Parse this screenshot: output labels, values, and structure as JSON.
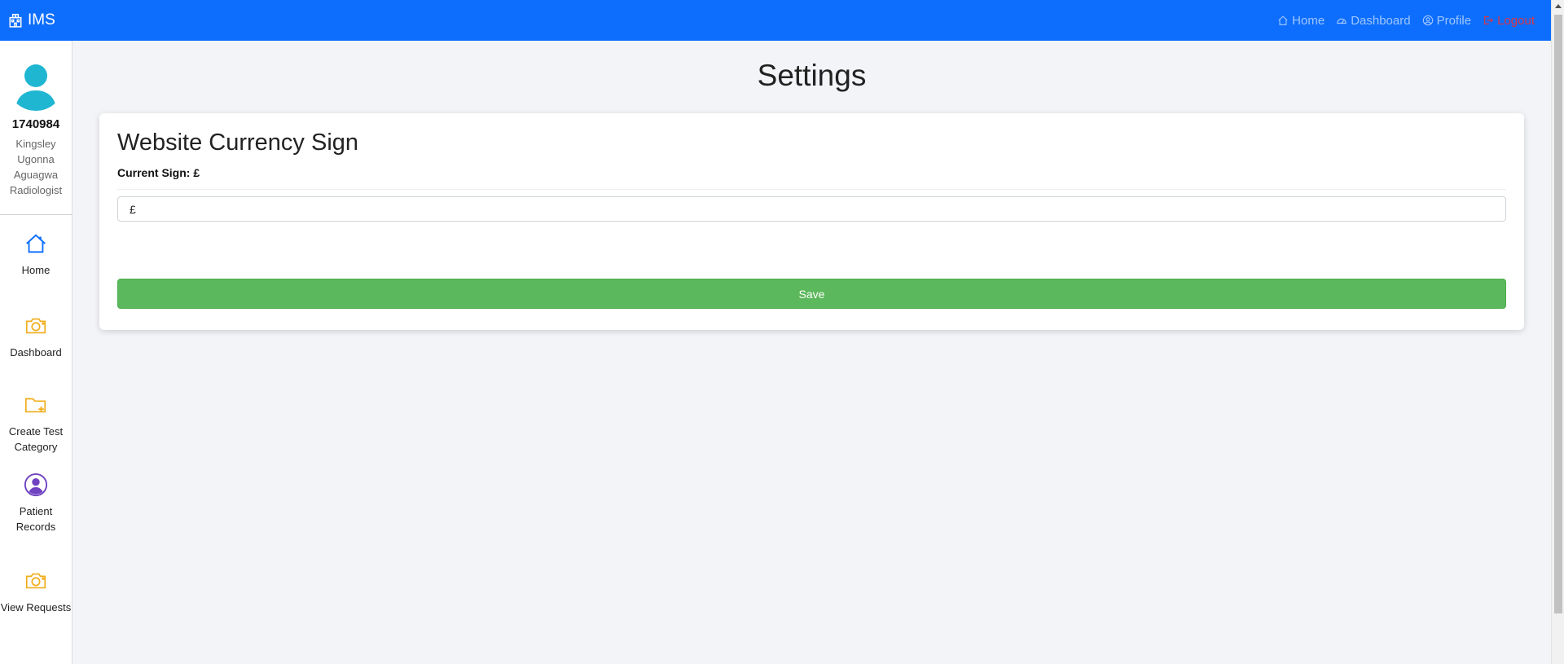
{
  "navbar": {
    "brand": "IMS",
    "links": {
      "home": "Home",
      "dashboard": "Dashboard",
      "profile": "Profile",
      "logout": "Logout"
    }
  },
  "sidebar": {
    "user_id": "1740984",
    "user_name": "Kingsley Ugonna Aguagwa",
    "user_role": "Radiologist",
    "items": [
      {
        "label": "Home",
        "icon": "home-icon",
        "color": "#0d6efd"
      },
      {
        "label": "Dashboard",
        "icon": "camera-icon",
        "color": "#f0ad1a"
      },
      {
        "label": "Create Test Category",
        "icon": "folder-plus-icon",
        "color": "#f0ad1a"
      },
      {
        "label": "Patient Records",
        "icon": "person-circle-icon",
        "color": "#6f42c1"
      },
      {
        "label": "View Requests",
        "icon": "camera-icon",
        "color": "#f0ad1a"
      }
    ]
  },
  "main": {
    "title": "Settings",
    "card": {
      "title": "Website Currency Sign",
      "current_sign": "Current Sign: £",
      "input_value": "£",
      "save_label": "Save"
    }
  },
  "colors": {
    "navbar": "#0d6efd",
    "save_button": "#5cb85c",
    "logout": "#dc3545",
    "avatar": "#1fb6d2"
  }
}
